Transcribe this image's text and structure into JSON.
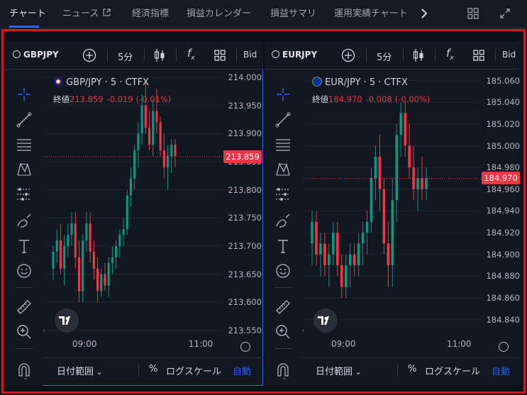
{
  "nav": {
    "tabs": [
      "チャート",
      "ニュース",
      "経済指標",
      "損益カレンダー",
      "損益サマリ",
      "運用実績チャート"
    ],
    "active_tab": 0,
    "next_icon": "chevron-right-icon",
    "layout_icon": "grid-layout-icon",
    "expand_icon": "fullscreen-icon"
  },
  "toolbar": {
    "interval": "5分",
    "fx_label": "f",
    "fx_sub": "x",
    "bid_label": "Bid"
  },
  "tools": [
    "crosshair-icon",
    "trend-line-icon",
    "fib-icon",
    "pattern-icon",
    "forecast-icon",
    "brush-icon",
    "text-icon",
    "emoji-icon",
    "ruler-icon",
    "zoom-icon",
    "magnet-icon"
  ],
  "panes": [
    {
      "symbol": "GBPJPY",
      "legend": "GBP/JPY · 5 · CTFX",
      "close_label": "終値",
      "close_value": "213.859",
      "change": "-0.019",
      "change_pct": "(-0.01%)",
      "price_tag": "213.859",
      "price_labels": [
        "214.000",
        "213.950",
        "213.900",
        "213.850",
        "213.800",
        "213.750",
        "213.700",
        "213.650",
        "213.600",
        "213.550"
      ],
      "time_labels": [
        "09:00",
        "11:00"
      ],
      "date_range": "日付範囲",
      "pct": "%",
      "log_scale": "ログスケール",
      "auto": "自動",
      "up_color": "#089981",
      "down_color": "#f23645"
    },
    {
      "symbol": "EURJPY",
      "legend": "EUR/JPY · 5 · CTFX",
      "close_label": "終値",
      "close_value": "184.970",
      "change": "-0.008",
      "change_pct": "(-0.00%)",
      "price_tag": "184.970",
      "price_labels": [
        "185.060",
        "185.040",
        "185.020",
        "185.000",
        "184.980",
        "184.960",
        "184.940",
        "184.920",
        "184.900",
        "184.880",
        "184.860",
        "184.840"
      ],
      "time_labels": [
        "09:00",
        "11:00"
      ],
      "date_range": "日付範囲",
      "pct": "%",
      "log_scale": "ログスケール",
      "auto": "自動",
      "up_color": "#089981",
      "down_color": "#f23645"
    }
  ],
  "chart_data": [
    {
      "type": "candlestick",
      "series_up_color": "#089981",
      "series_down_color": "#f23645",
      "ylim": [
        213.55,
        214.0
      ],
      "last_price": 213.859,
      "candles": [
        [
          213.66,
          213.7,
          213.64,
          213.69
        ],
        [
          213.69,
          213.73,
          213.67,
          213.71
        ],
        [
          213.71,
          213.74,
          213.65,
          213.66
        ],
        [
          213.66,
          213.72,
          213.63,
          213.7
        ],
        [
          213.7,
          213.74,
          213.68,
          213.72
        ],
        [
          213.72,
          213.76,
          213.7,
          213.74
        ],
        [
          213.74,
          213.76,
          213.66,
          213.68
        ],
        [
          213.68,
          213.71,
          213.6,
          213.62
        ],
        [
          213.62,
          213.72,
          213.6,
          213.71
        ],
        [
          213.71,
          213.76,
          213.69,
          213.74
        ],
        [
          213.74,
          213.76,
          213.67,
          213.69
        ],
        [
          213.69,
          213.71,
          213.64,
          213.66
        ],
        [
          213.66,
          213.68,
          213.6,
          213.62
        ],
        [
          213.62,
          213.66,
          213.61,
          213.65
        ],
        [
          213.65,
          213.67,
          213.62,
          213.63
        ],
        [
          213.63,
          213.68,
          213.61,
          213.67
        ],
        [
          213.67,
          213.7,
          213.65,
          213.68
        ],
        [
          213.68,
          213.71,
          213.66,
          213.7
        ],
        [
          213.7,
          213.73,
          213.68,
          213.72
        ],
        [
          213.72,
          213.75,
          213.7,
          213.73
        ],
        [
          213.73,
          213.8,
          213.72,
          213.79
        ],
        [
          213.79,
          213.84,
          213.77,
          213.82
        ],
        [
          213.82,
          213.88,
          213.8,
          213.87
        ],
        [
          213.87,
          213.92,
          213.84,
          213.9
        ],
        [
          213.9,
          213.97,
          213.88,
          213.95
        ],
        [
          213.95,
          213.99,
          213.9,
          213.91
        ],
        [
          213.91,
          213.94,
          213.87,
          213.88
        ],
        [
          213.88,
          213.96,
          213.86,
          213.94
        ],
        [
          213.94,
          213.98,
          213.9,
          213.92
        ],
        [
          213.92,
          213.93,
          213.86,
          213.87
        ],
        [
          213.87,
          213.9,
          213.82,
          213.84
        ],
        [
          213.84,
          213.88,
          213.8,
          213.86
        ],
        [
          213.86,
          213.89,
          213.83,
          213.88
        ],
        [
          213.88,
          213.89,
          213.84,
          213.86
        ]
      ]
    },
    {
      "type": "candlestick",
      "series_up_color": "#089981",
      "series_down_color": "#f23645",
      "ylim": [
        184.83,
        185.063
      ],
      "last_price": 184.97,
      "candles": [
        [
          184.91,
          184.94,
          184.89,
          184.93
        ],
        [
          184.93,
          184.94,
          184.89,
          184.9
        ],
        [
          184.9,
          184.92,
          184.88,
          184.91
        ],
        [
          184.91,
          184.92,
          184.88,
          184.89
        ],
        [
          184.89,
          184.91,
          184.87,
          184.9
        ],
        [
          184.9,
          184.93,
          184.89,
          184.92
        ],
        [
          184.92,
          184.93,
          184.88,
          184.89
        ],
        [
          184.89,
          184.9,
          184.86,
          184.87
        ],
        [
          184.87,
          184.9,
          184.86,
          184.89
        ],
        [
          184.89,
          184.91,
          184.87,
          184.9
        ],
        [
          184.9,
          184.91,
          184.88,
          184.89
        ],
        [
          184.89,
          184.92,
          184.88,
          184.91
        ],
        [
          184.91,
          184.93,
          184.89,
          184.92
        ],
        [
          184.92,
          184.94,
          184.9,
          184.93
        ],
        [
          184.93,
          184.98,
          184.92,
          184.97
        ],
        [
          184.97,
          185.0,
          184.95,
          184.99
        ],
        [
          184.99,
          185.01,
          184.94,
          184.96
        ],
        [
          184.96,
          184.97,
          184.9,
          184.91
        ],
        [
          184.91,
          184.93,
          184.87,
          184.89
        ],
        [
          184.89,
          184.97,
          184.87,
          184.95
        ],
        [
          184.95,
          185.02,
          184.93,
          185.01
        ],
        [
          185.01,
          185.04,
          184.99,
          185.03
        ],
        [
          185.03,
          185.04,
          184.99,
          185.0
        ],
        [
          185.0,
          185.02,
          184.97,
          184.98
        ],
        [
          184.98,
          185.0,
          184.95,
          184.96
        ],
        [
          184.96,
          184.98,
          184.94,
          184.97
        ],
        [
          184.97,
          184.99,
          184.95,
          184.96
        ],
        [
          184.96,
          184.98,
          184.95,
          184.97
        ]
      ]
    }
  ]
}
